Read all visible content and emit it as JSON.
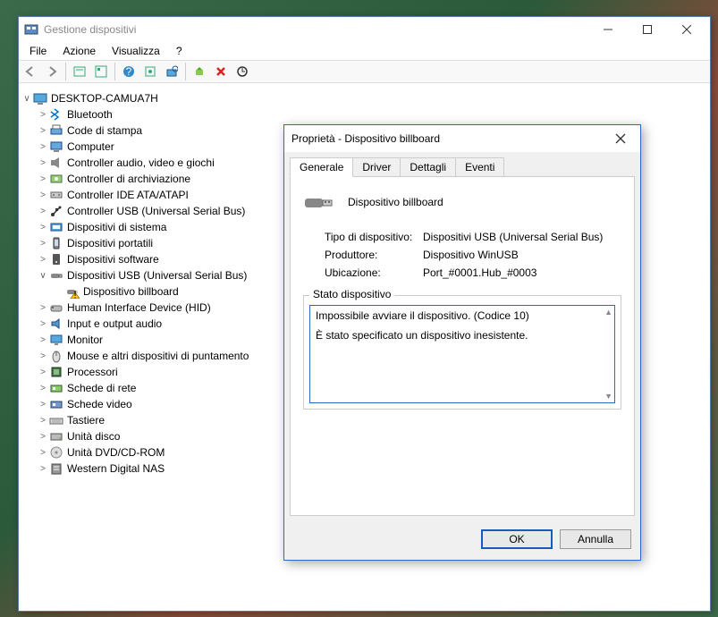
{
  "window": {
    "title": "Gestione dispositivi",
    "menus": [
      "File",
      "Azione",
      "Visualizza",
      "?"
    ]
  },
  "tree": {
    "root": "DESKTOP-CAMUA7H",
    "items": [
      {
        "label": "Bluetooth",
        "icon": "bt"
      },
      {
        "label": "Code di stampa",
        "icon": "printer"
      },
      {
        "label": "Computer",
        "icon": "computer"
      },
      {
        "label": "Controller audio, video e giochi",
        "icon": "audio"
      },
      {
        "label": "Controller di archiviazione",
        "icon": "storage"
      },
      {
        "label": "Controller IDE ATA/ATAPI",
        "icon": "ide"
      },
      {
        "label": "Controller USB (Universal Serial Bus)",
        "icon": "usb"
      },
      {
        "label": "Dispositivi di sistema",
        "icon": "system"
      },
      {
        "label": "Dispositivi portatili",
        "icon": "portable"
      },
      {
        "label": "Dispositivi software",
        "icon": "software"
      },
      {
        "label": "Dispositivi USB (Universal Serial Bus)",
        "icon": "usb2",
        "expanded": true,
        "children": [
          {
            "label": "Dispositivo billboard",
            "icon": "warn"
          }
        ]
      },
      {
        "label": "Human Interface Device (HID)",
        "icon": "hid"
      },
      {
        "label": "Input e output audio",
        "icon": "audioio"
      },
      {
        "label": "Monitor",
        "icon": "monitor"
      },
      {
        "label": "Mouse e altri dispositivi di puntamento",
        "icon": "mouse"
      },
      {
        "label": "Processori",
        "icon": "cpu"
      },
      {
        "label": "Schede di rete",
        "icon": "net"
      },
      {
        "label": "Schede video",
        "icon": "video"
      },
      {
        "label": "Tastiere",
        "icon": "kb"
      },
      {
        "label": "Unità disco",
        "icon": "disk"
      },
      {
        "label": "Unità DVD/CD-ROM",
        "icon": "dvd"
      },
      {
        "label": "Western Digital NAS",
        "icon": "nas"
      }
    ]
  },
  "dialog": {
    "title": "Proprietà - Dispositivo billboard",
    "tabs": [
      "Generale",
      "Driver",
      "Dettagli",
      "Eventi"
    ],
    "active_tab": 0,
    "device_name": "Dispositivo billboard",
    "kv": [
      {
        "k": "Tipo di dispositivo:",
        "v": "Dispositivi USB (Universal Serial Bus)"
      },
      {
        "k": "Produttore:",
        "v": "Dispositivo WinUSB"
      },
      {
        "k": "Ubicazione:",
        "v": "Port_#0001.Hub_#0003"
      }
    ],
    "status_label": "Stato dispositivo",
    "status_lines": [
      "Impossibile avviare il dispositivo. (Codice 10)",
      "È stato specificato un dispositivo inesistente."
    ],
    "buttons": {
      "ok": "OK",
      "cancel": "Annulla"
    }
  }
}
